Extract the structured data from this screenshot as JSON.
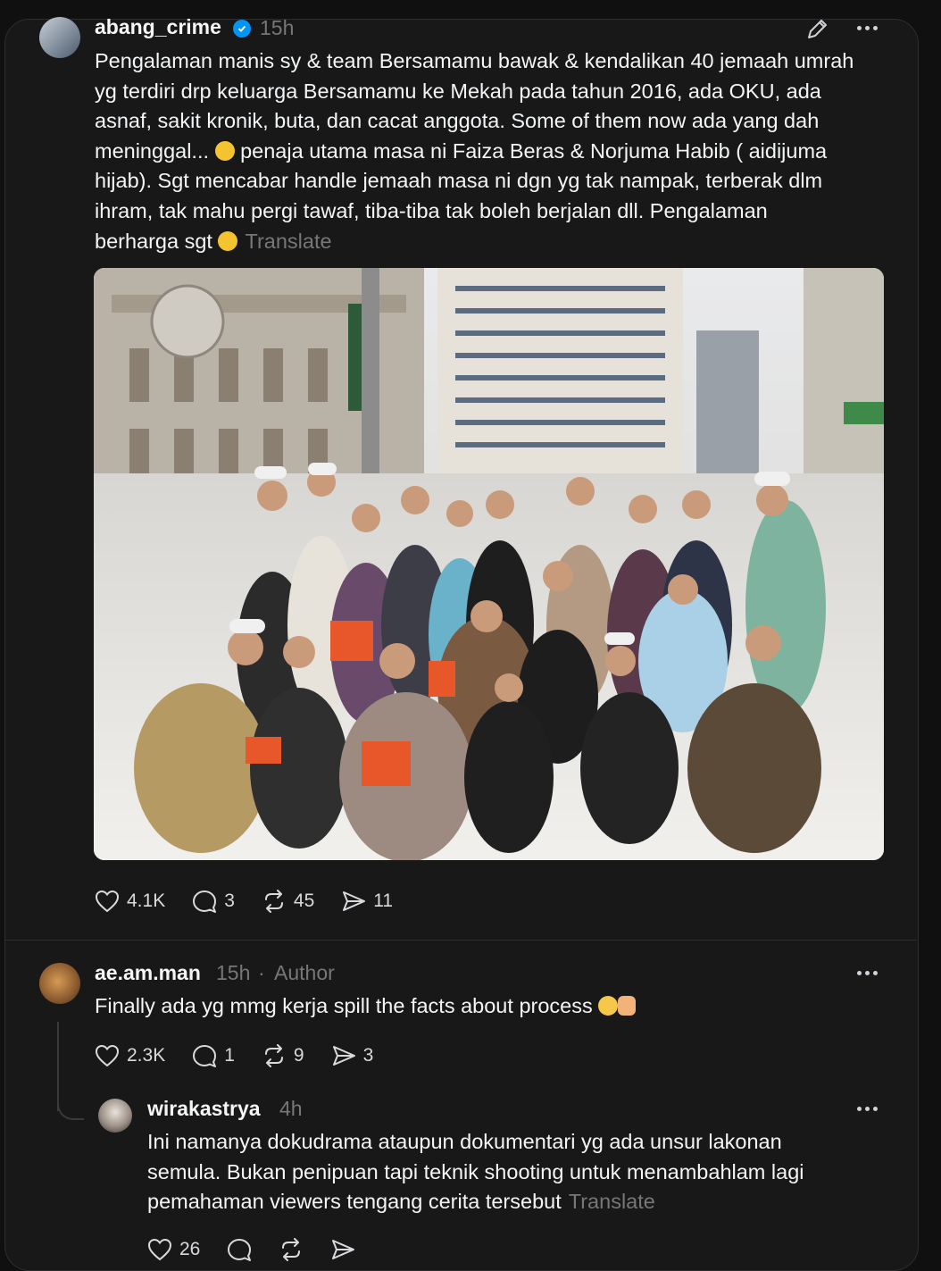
{
  "colors": {
    "background": "#101010",
    "card": "#181818",
    "text": "#f3f5f7",
    "muted": "#777777",
    "verified": "#0095f6"
  },
  "post": {
    "username": "abang_crime",
    "time": "15h",
    "lines": [
      "Pengalaman manis sy & team Bersamamu bawak & kendalikan 40 jemaah umrah",
      "yg terdiri drp keluarga Bersamamu ke Mekah pada tahun 2016, ada OKU, ada",
      "asnaf, sakit kronik, buta, dan cacat anggota. Some of them now ada yang dah",
      "meninggal...",
      "penaja utama masa ni Faiza Beras & Norjuma Habib ( aidijuma",
      "hijab). Sgt mencabar handle jemaah masa ni dgn yg tak nampak, terberak dlm",
      "ihram, tak mahu pergi tawaf, tiba-tiba tak boleh berjalan dll. Pengalaman",
      "berharga sgt"
    ],
    "translate": "Translate",
    "likes": "4.1K",
    "replies": "3",
    "reposts": "45",
    "shares": "11"
  },
  "reply1": {
    "username": "ae.am.man",
    "time": "15h",
    "separator": "·",
    "badge": "Author",
    "text": "Finally ada yg mmg kerja spill the facts about process",
    "likes": "2.3K",
    "replies": "1",
    "reposts": "9",
    "shares": "3"
  },
  "reply2": {
    "username": "wirakastrya",
    "time": "4h",
    "lines": [
      "Ini namanya dokudrama ataupun dokumentari yg ada unsur lakonan",
      "semula. Bukan penipuan tapi teknik shooting untuk menambahlam lagi",
      "pemahaman viewers tengang cerita tersebut"
    ],
    "translate": "Translate",
    "likes": "26"
  }
}
